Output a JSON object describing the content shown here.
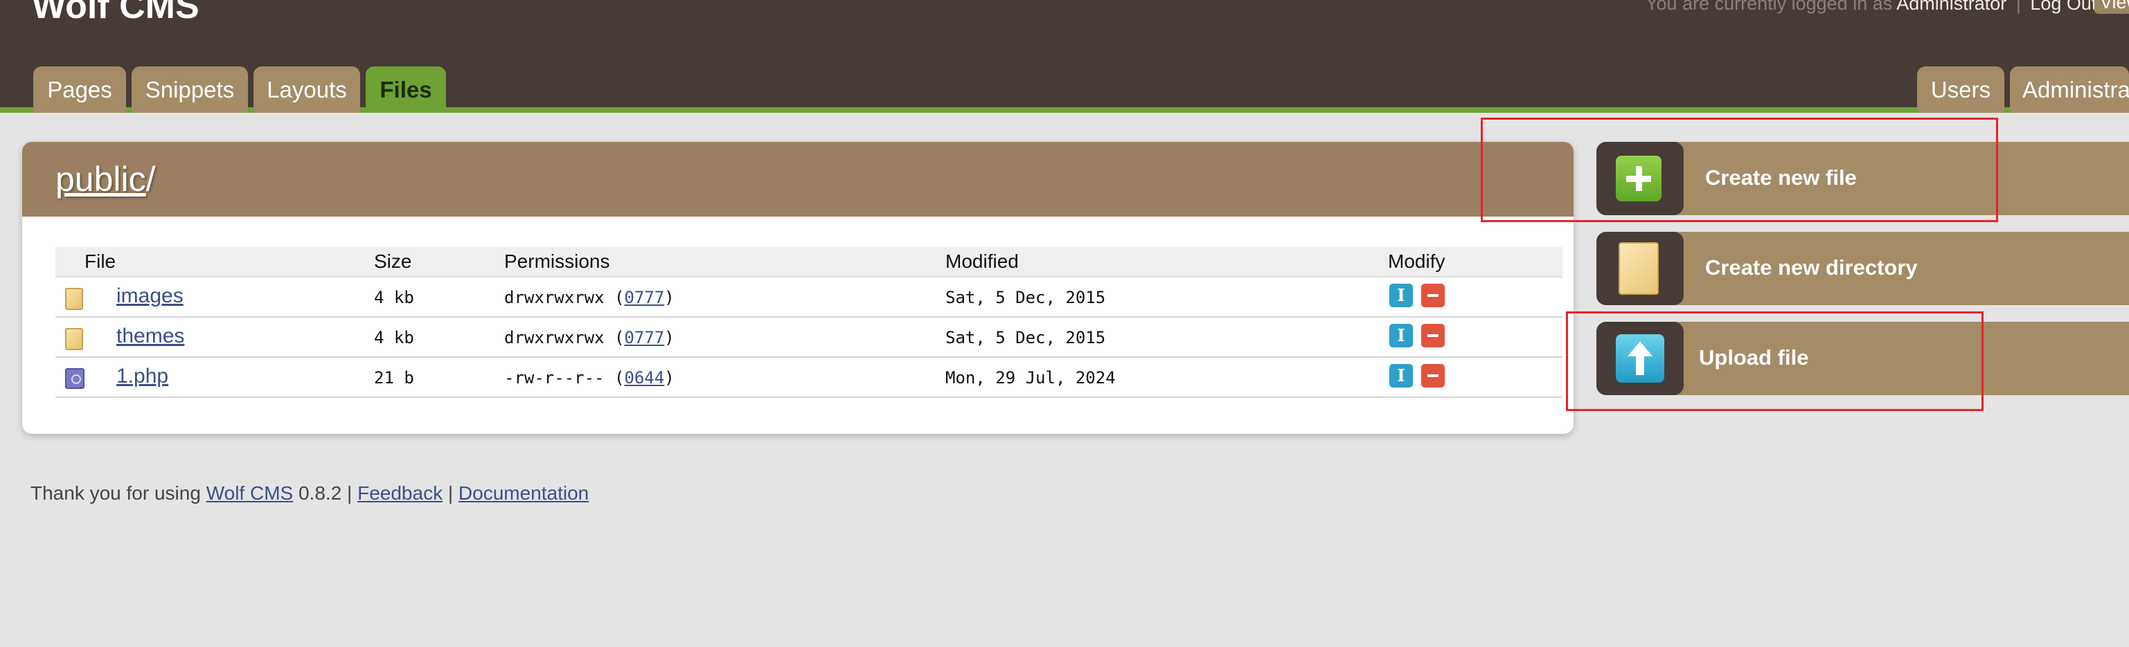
{
  "header": {
    "site_title": "Wolf CMS",
    "user_bar": {
      "prefix": "You are currently logged in as",
      "username": "Administrator",
      "separator": "|",
      "logout_label": "Log Out",
      "separator_2": "|",
      "view_site_label": "View"
    },
    "tabs": [
      {
        "label": "Pages",
        "active": false
      },
      {
        "label": "Snippets",
        "active": false
      },
      {
        "label": "Layouts",
        "active": false
      },
      {
        "label": "Files",
        "active": true
      },
      {
        "label": "Users",
        "active": false
      },
      {
        "label": "Administration",
        "active": false
      }
    ],
    "colors": {
      "header_bg": "#463b36",
      "tab_bg": "#a48c66",
      "active_tab_bg": "#6fa234"
    }
  },
  "main": {
    "breadcrumb": {
      "link": "public",
      "suffix": "/"
    },
    "table": {
      "columns": [
        "File",
        "Size",
        "Permissions",
        "Modified",
        "Modify"
      ],
      "rows": [
        {
          "name": "images",
          "type_icon": "folder-icon",
          "size": "4 kb",
          "perm": "drwxrwxrwx",
          "perm_open": "(",
          "octal": "0777",
          "perm_close": ")",
          "modified": "Sat, 5 Dec, 2015",
          "rename_icon": "rename-icon",
          "delete_icon": "delete-icon"
        },
        {
          "name": "themes",
          "type_icon": "folder-icon",
          "size": "4 kb",
          "perm": "drwxrwxrwx",
          "perm_open": "(",
          "octal": "0777",
          "perm_close": ")",
          "modified": "Sat, 5 Dec, 2015",
          "rename_icon": "rename-icon",
          "delete_icon": "delete-icon"
        },
        {
          "name": "1.php",
          "type_icon": "php-file-icon",
          "size": "21 b",
          "perm": "-rw-r--r--",
          "perm_open": "(",
          "octal": "0644",
          "perm_close": ")",
          "modified": "Mon, 29 Jul, 2024",
          "rename_icon": "rename-icon",
          "delete_icon": "delete-icon"
        }
      ]
    }
  },
  "sidebar": {
    "actions": [
      {
        "label": "Create new file",
        "icon": "plus-icon"
      },
      {
        "label": "Create new directory",
        "icon": "folder-icon"
      },
      {
        "label": "Upload file",
        "icon": "upload-icon"
      }
    ]
  },
  "footer": {
    "prefix": "Thank you for using",
    "app_link": "Wolf CMS",
    "version": "0.8.2",
    "sep1": "|",
    "feedback_link": "Feedback",
    "sep2": "|",
    "docs_link": "Documentation"
  }
}
